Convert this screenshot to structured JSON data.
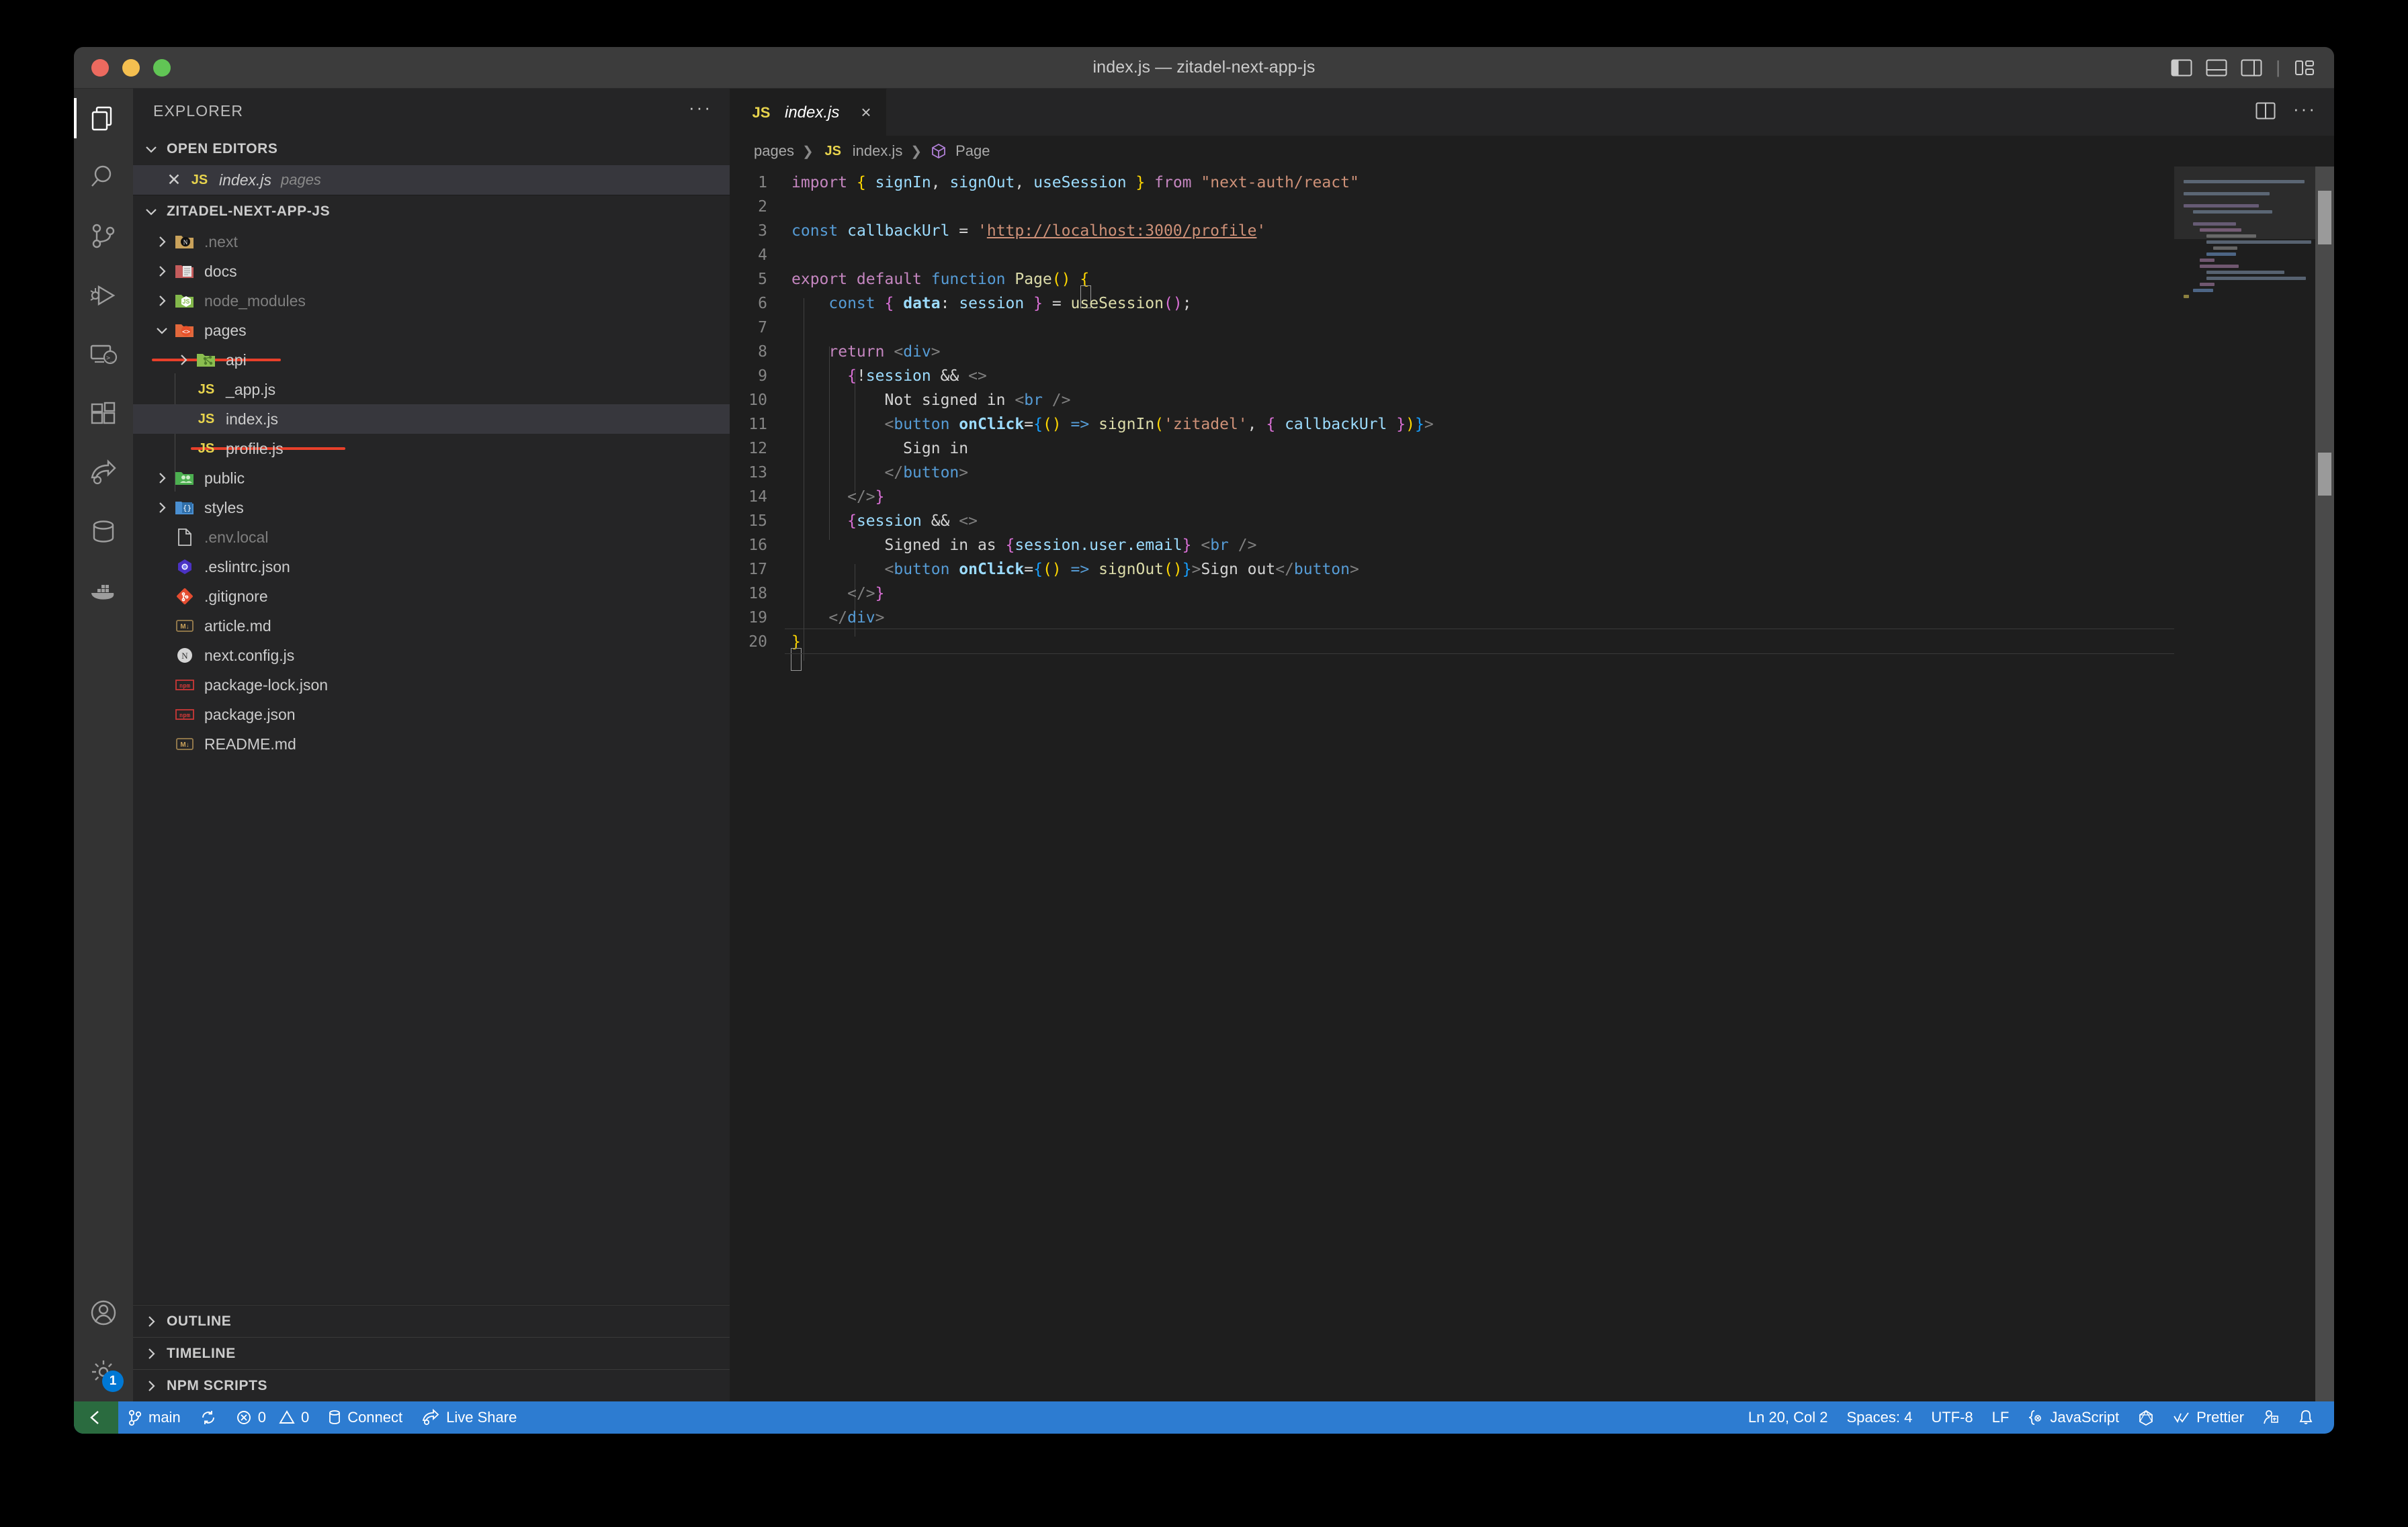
{
  "window": {
    "title": "index.js — zitadel-next-app-js",
    "traffic_lights": [
      "close",
      "minimize",
      "zoom"
    ],
    "layout_actions": [
      {
        "name": "toggle-primary-sidebar",
        "label": "Toggle Primary Side Bar"
      },
      {
        "name": "toggle-panel",
        "label": "Toggle Panel"
      },
      {
        "name": "toggle-secondary-sidebar",
        "label": "Toggle Secondary Side Bar"
      },
      {
        "name": "customize-layout",
        "label": "Customize Layout"
      }
    ]
  },
  "activity_bar": {
    "items": [
      {
        "icon": "files-icon",
        "label": "Explorer",
        "active": true
      },
      {
        "icon": "search-icon",
        "label": "Search",
        "active": false
      },
      {
        "icon": "source-control-icon",
        "label": "Source Control",
        "active": false
      },
      {
        "icon": "run-debug-icon",
        "label": "Run and Debug",
        "active": false
      },
      {
        "icon": "remote-explorer-icon",
        "label": "Remote Explorer",
        "active": false
      },
      {
        "icon": "extensions-icon",
        "label": "Extensions",
        "active": false
      },
      {
        "icon": "live-share-icon",
        "label": "Live Share",
        "active": false
      },
      {
        "icon": "database-icon",
        "label": "Database",
        "active": false
      },
      {
        "icon": "docker-icon",
        "label": "Docker",
        "active": false
      }
    ],
    "bottom": [
      {
        "icon": "account-icon",
        "label": "Accounts",
        "badge": ""
      },
      {
        "icon": "gear-icon",
        "label": "Manage",
        "badge": "1"
      }
    ]
  },
  "sidebar": {
    "title": "EXPLORER",
    "more_actions": "···",
    "open_editors": {
      "title": "OPEN EDITORS",
      "expanded": true,
      "items": [
        {
          "name": "index.js",
          "folder": "pages",
          "icon": "js-file-icon",
          "selected": true,
          "dirty": false
        }
      ]
    },
    "project": {
      "title": "ZITADEL-NEXT-APP-JS",
      "expanded": true,
      "tree": [
        {
          "label": ".next",
          "type": "folder",
          "icon": "next-folder-icon",
          "depth": 0,
          "expanded": false,
          "dim": true
        },
        {
          "label": "docs",
          "type": "folder",
          "icon": "docs-folder-icon",
          "depth": 0,
          "expanded": false,
          "dim": false
        },
        {
          "label": "node_modules",
          "type": "folder",
          "icon": "node-folder-icon",
          "depth": 0,
          "expanded": false,
          "dim": true
        },
        {
          "label": "pages",
          "type": "folder",
          "icon": "pages-folder-icon",
          "depth": 0,
          "expanded": true,
          "dim": false,
          "annotated": true
        },
        {
          "label": "api",
          "type": "folder",
          "icon": "api-folder-icon",
          "depth": 1,
          "expanded": false,
          "dim": false
        },
        {
          "label": "_app.js",
          "type": "file",
          "icon": "js-file-icon",
          "depth": 1,
          "dim": false
        },
        {
          "label": "index.js",
          "type": "file",
          "icon": "js-file-icon",
          "depth": 1,
          "dim": false,
          "selected": true,
          "annotated": true
        },
        {
          "label": "profile.js",
          "type": "file",
          "icon": "js-file-icon",
          "depth": 1,
          "dim": false
        },
        {
          "label": "public",
          "type": "folder",
          "icon": "public-folder-icon",
          "depth": 0,
          "expanded": false,
          "dim": false
        },
        {
          "label": "styles",
          "type": "folder",
          "icon": "styles-folder-icon",
          "depth": 0,
          "expanded": false,
          "dim": false
        },
        {
          "label": ".env.local",
          "type": "file",
          "icon": "plain-file-icon",
          "depth": 0,
          "dim": true
        },
        {
          "label": ".eslintrc.json",
          "type": "file",
          "icon": "eslint-file-icon",
          "depth": 0,
          "dim": false
        },
        {
          "label": ".gitignore",
          "type": "file",
          "icon": "git-file-icon",
          "depth": 0,
          "dim": false
        },
        {
          "label": "article.md",
          "type": "file",
          "icon": "markdown-file-icon",
          "depth": 0,
          "dim": false
        },
        {
          "label": "next.config.js",
          "type": "file",
          "icon": "next-file-icon",
          "depth": 0,
          "dim": false
        },
        {
          "label": "package-lock.json",
          "type": "file",
          "icon": "npm-file-icon",
          "depth": 0,
          "dim": false
        },
        {
          "label": "package.json",
          "type": "file",
          "icon": "npm-file-icon",
          "depth": 0,
          "dim": false
        },
        {
          "label": "README.md",
          "type": "file",
          "icon": "markdown-file-icon",
          "depth": 0,
          "dim": false
        }
      ]
    },
    "bottom_sections": [
      {
        "title": "OUTLINE",
        "expanded": false
      },
      {
        "title": "TIMELINE",
        "expanded": false
      },
      {
        "title": "NPM SCRIPTS",
        "expanded": false
      }
    ]
  },
  "editor": {
    "tabs": [
      {
        "label": "index.js",
        "icon": "js-file-icon",
        "active": true,
        "close": "×"
      }
    ],
    "actions": [
      {
        "name": "split-editor-icon",
        "label": "Split Editor Right"
      },
      {
        "name": "more-actions-icon",
        "label": "More Actions..."
      }
    ],
    "breadcrumbs": [
      {
        "label": "pages",
        "icon": ""
      },
      {
        "label": "index.js",
        "icon": "js-file-icon"
      },
      {
        "label": "Page",
        "icon": "symbol-function-icon"
      }
    ],
    "lines": [
      {
        "n": 1,
        "text": "import { signIn, signOut, useSession } from \"next-auth/react\""
      },
      {
        "n": 2,
        "text": ""
      },
      {
        "n": 3,
        "text": "const callbackUrl = 'http://localhost:3000/profile'"
      },
      {
        "n": 4,
        "text": ""
      },
      {
        "n": 5,
        "text": "export default function Page() {"
      },
      {
        "n": 6,
        "text": "    const { data: session } = useSession();"
      },
      {
        "n": 7,
        "text": ""
      },
      {
        "n": 8,
        "text": "    return <div>"
      },
      {
        "n": 9,
        "text": "      {!session && <>"
      },
      {
        "n": 10,
        "text": "          Not signed in <br />"
      },
      {
        "n": 11,
        "text": "          <button onClick={() => signIn('zitadel', { callbackUrl })}>"
      },
      {
        "n": 12,
        "text": "            Sign in"
      },
      {
        "n": 13,
        "text": "          </button>"
      },
      {
        "n": 14,
        "text": "      </>}"
      },
      {
        "n": 15,
        "text": "      {session && <>"
      },
      {
        "n": 16,
        "text": "          Signed in as {session.user.email} <br />"
      },
      {
        "n": 17,
        "text": "          <button onClick={() => signOut()}>Sign out</button>"
      },
      {
        "n": 18,
        "text": "      </>}"
      },
      {
        "n": 19,
        "text": "    </div>"
      },
      {
        "n": 20,
        "text": "}"
      }
    ],
    "current_line": 20
  },
  "status_bar": {
    "remote_label": "Open a Remote Window",
    "left": [
      {
        "name": "branch",
        "icon": "source-control-icon",
        "label": "main"
      },
      {
        "name": "sync",
        "icon": "sync-icon",
        "label": ""
      },
      {
        "name": "problems",
        "icon": "error-warning-icon",
        "label": "0 0",
        "errors": "0",
        "warnings": "0"
      },
      {
        "name": "connect",
        "icon": "database-icon",
        "label": "Connect"
      },
      {
        "name": "live-share",
        "icon": "live-share-icon",
        "label": "Live Share"
      }
    ],
    "right": [
      {
        "name": "cursor-position",
        "label": "Ln 20, Col 2"
      },
      {
        "name": "indentation",
        "label": "Spaces: 4"
      },
      {
        "name": "encoding",
        "label": "UTF-8"
      },
      {
        "name": "eol",
        "label": "LF"
      },
      {
        "name": "language-mode",
        "icon": "javascript-icon",
        "label": "JavaScript"
      },
      {
        "name": "graphql-status",
        "icon": "graphql-icon",
        "label": ""
      },
      {
        "name": "prettier",
        "icon": "check-icon",
        "label": "Prettier"
      },
      {
        "name": "remote-profile",
        "icon": "person-add-icon",
        "label": ""
      },
      {
        "name": "notifications",
        "icon": "bell-icon",
        "label": ""
      }
    ]
  },
  "colors": {
    "accent": "#2d7cd1",
    "remote_green": "#2a6b3f",
    "editor_bg": "#1e1e1e",
    "sidebar_bg": "#252526",
    "activitybar_bg": "#333333",
    "titlebar_bg": "#3c3c3c",
    "annotation_red": "#e8402a",
    "js_yellow": "#e8d44d"
  }
}
